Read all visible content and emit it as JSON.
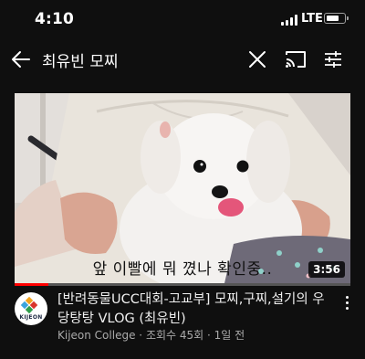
{
  "status_bar": {
    "time": "4:10",
    "network": "LTE"
  },
  "search": {
    "query": "최유빈 모찌"
  },
  "icons": {
    "back": "back-arrow-icon",
    "clear": "close-icon",
    "cast": "cast-icon",
    "filter": "filter-sliders-icon",
    "menu": "more-vertical-icon"
  },
  "video": {
    "caption": "앞 이빨에 뭐 꼈나 확인중..",
    "duration": "3:56",
    "progress_fraction": 0.1,
    "title": "[반려동물UCC대회-고교부] 모찌,구찌,설기의 우당탕탕 VLOG (최유빈)",
    "channel": "Kijeon College",
    "views": "조회수 45회",
    "uploaded": "1일 전",
    "separator": "·"
  },
  "channel_avatar": {
    "label": "KIJEON"
  },
  "colors": {
    "background": "#0f0f0f",
    "progress": "#ff0000",
    "meta_text": "#aaaaaa"
  }
}
